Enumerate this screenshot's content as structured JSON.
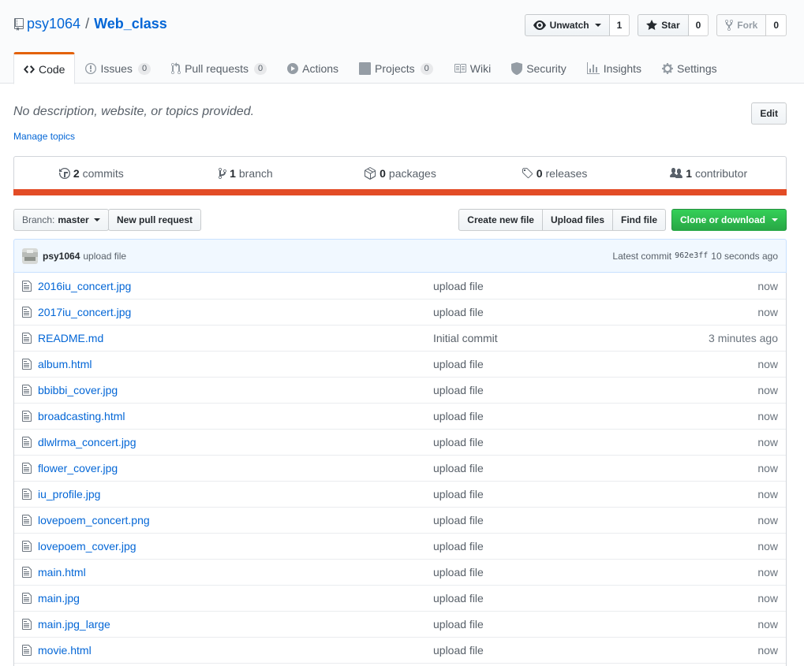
{
  "repo": {
    "owner": "psy1064",
    "separator": "/",
    "name": "Web_class"
  },
  "actions": {
    "watch": {
      "label": "Unwatch",
      "count": "1"
    },
    "star": {
      "label": "Star",
      "count": "0"
    },
    "fork": {
      "label": "Fork",
      "count": "0"
    }
  },
  "nav": {
    "tabs": [
      {
        "label": "Code",
        "icon": "code-icon",
        "selected": true
      },
      {
        "label": "Issues",
        "icon": "issue-opened-icon",
        "count": "0"
      },
      {
        "label": "Pull requests",
        "icon": "git-pull-request-icon",
        "count": "0"
      },
      {
        "label": "Actions",
        "icon": "play-icon"
      },
      {
        "label": "Projects",
        "icon": "project-icon",
        "count": "0"
      },
      {
        "label": "Wiki",
        "icon": "book-icon"
      },
      {
        "label": "Security",
        "icon": "shield-icon"
      },
      {
        "label": "Insights",
        "icon": "graph-icon"
      },
      {
        "label": "Settings",
        "icon": "gear-icon"
      }
    ]
  },
  "description": {
    "text": "No description, website, or topics provided.",
    "edit_label": "Edit",
    "manage_topics": "Manage topics"
  },
  "summary": {
    "commits": {
      "count": "2",
      "label": "commits"
    },
    "branches": {
      "count": "1",
      "label": "branch"
    },
    "packages": {
      "count": "0",
      "label": "packages"
    },
    "releases": {
      "count": "0",
      "label": "releases"
    },
    "contributors": {
      "count": "1",
      "label": "contributor"
    },
    "language_color": "#e34c26"
  },
  "file_nav": {
    "branch_prefix": "Branch:",
    "branch_name": "master",
    "new_pr": "New pull request",
    "create_file": "Create new file",
    "upload_files": "Upload files",
    "find_file": "Find file",
    "clone": "Clone or download"
  },
  "latest_commit": {
    "author": "psy1064",
    "message": "upload file",
    "prefix": "Latest commit",
    "sha": "962e3ff",
    "time": "10 seconds ago"
  },
  "files": [
    {
      "name": "2016iu_concert.jpg",
      "message": "upload file",
      "age": "now"
    },
    {
      "name": "2017iu_concert.jpg",
      "message": "upload file",
      "age": "now"
    },
    {
      "name": "README.md",
      "message": "Initial commit",
      "age": "3 minutes ago"
    },
    {
      "name": "album.html",
      "message": "upload file",
      "age": "now"
    },
    {
      "name": "bbibbi_cover.jpg",
      "message": "upload file",
      "age": "now"
    },
    {
      "name": "broadcasting.html",
      "message": "upload file",
      "age": "now"
    },
    {
      "name": "dlwlrma_concert.jpg",
      "message": "upload file",
      "age": "now"
    },
    {
      "name": "flower_cover.jpg",
      "message": "upload file",
      "age": "now"
    },
    {
      "name": "iu_profile.jpg",
      "message": "upload file",
      "age": "now"
    },
    {
      "name": "lovepoem_concert.png",
      "message": "upload file",
      "age": "now"
    },
    {
      "name": "lovepoem_cover.jpg",
      "message": "upload file",
      "age": "now"
    },
    {
      "name": "main.html",
      "message": "upload file",
      "age": "now"
    },
    {
      "name": "main.jpg",
      "message": "upload file",
      "age": "now"
    },
    {
      "name": "main.jpg_large",
      "message": "upload file",
      "age": "now"
    },
    {
      "name": "movie.html",
      "message": "upload file",
      "age": "now"
    },
    {
      "name": "",
      "message": "",
      "age": ""
    }
  ]
}
